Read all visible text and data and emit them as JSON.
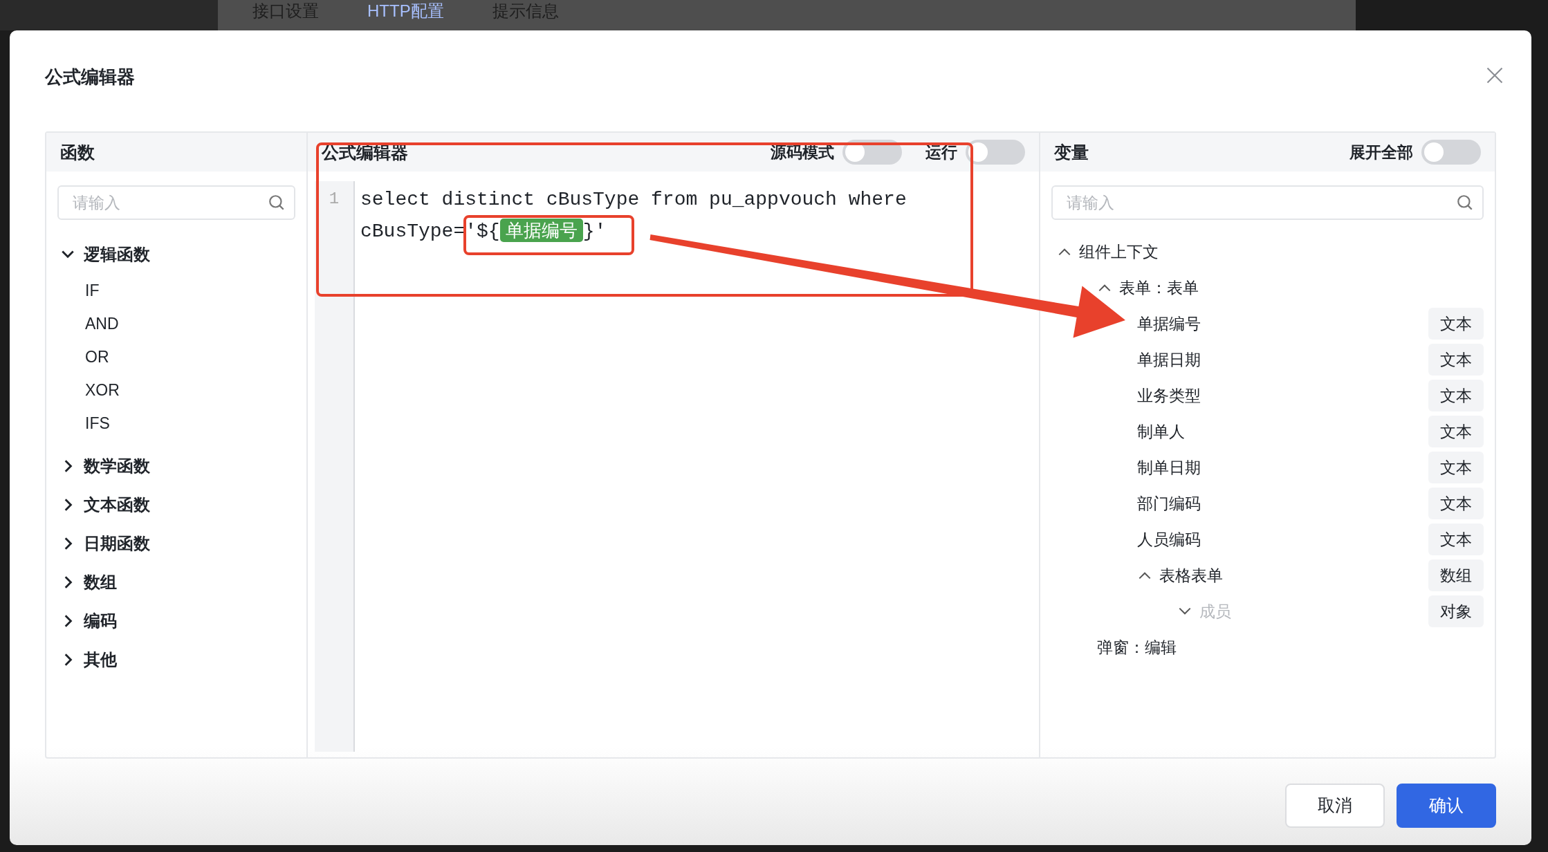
{
  "background": {
    "tabs": [
      {
        "label": "接口设置",
        "selected": false
      },
      {
        "label": "HTTP配置",
        "selected": true
      },
      {
        "label": "提示信息",
        "selected": false
      }
    ]
  },
  "dialog": {
    "title": "公式编辑器",
    "functions_panel": {
      "title": "函数",
      "search": {
        "placeholder": "请输入"
      },
      "groups": [
        {
          "label": "逻辑函数",
          "expanded": true,
          "children": [
            {
              "label": "IF"
            },
            {
              "label": "AND"
            },
            {
              "label": "OR"
            },
            {
              "label": "XOR"
            },
            {
              "label": "IFS"
            }
          ]
        },
        {
          "label": "数学函数",
          "expanded": false
        },
        {
          "label": "文本函数",
          "expanded": false
        },
        {
          "label": "日期函数",
          "expanded": false
        },
        {
          "label": "数组",
          "expanded": false
        },
        {
          "label": "编码",
          "expanded": false
        },
        {
          "label": "其他",
          "expanded": false
        }
      ]
    },
    "editor_panel": {
      "title": "公式编辑器",
      "toggles": [
        {
          "label": "源码模式",
          "on": false
        },
        {
          "label": "运行",
          "on": false
        }
      ],
      "code": {
        "line_number": "1",
        "before": "select distinct cBusType from pu_appvouch where cBusType='${",
        "token": "单据编号",
        "after": "}'"
      }
    },
    "variables_panel": {
      "title": "变量",
      "toggle": {
        "label": "展开全部",
        "on": false
      },
      "search": {
        "placeholder": "请输入"
      },
      "tree": [
        {
          "label": "组件上下文",
          "expanded": true,
          "children": [
            {
              "label": "表单：表单",
              "expanded": true,
              "children": [
                {
                  "label": "单据编号",
                  "type": "文本"
                },
                {
                  "label": "单据日期",
                  "type": "文本"
                },
                {
                  "label": "业务类型",
                  "type": "文本"
                },
                {
                  "label": "制单人",
                  "type": "文本"
                },
                {
                  "label": "制单日期",
                  "type": "文本"
                },
                {
                  "label": "部门编码",
                  "type": "文本"
                },
                {
                  "label": "人员编码",
                  "type": "文本"
                },
                {
                  "label": "表格表单",
                  "type": "数组",
                  "expanded": true,
                  "children": [
                    {
                      "label": "成员",
                      "type": "对象",
                      "expanded": false,
                      "disabled": true
                    }
                  ]
                }
              ]
            },
            {
              "label": "弹窗：编辑"
            }
          ]
        }
      ]
    },
    "buttons": [
      {
        "label": "取消",
        "kind": "secondary"
      },
      {
        "label": "确认",
        "kind": "primary"
      }
    ]
  }
}
